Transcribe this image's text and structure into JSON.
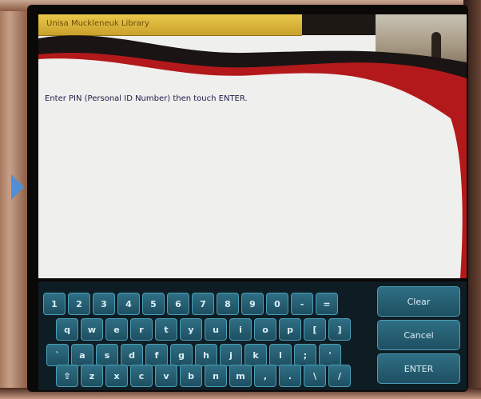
{
  "screen": {
    "library_name": "Unisa Muckleneuk Library",
    "prompt": "Enter PIN (Personal ID Number) then touch ENTER."
  },
  "keyboard": {
    "row1": [
      "1",
      "2",
      "3",
      "4",
      "5",
      "6",
      "7",
      "8",
      "9",
      "0",
      "-",
      "="
    ],
    "row2": [
      "q",
      "w",
      "e",
      "r",
      "t",
      "y",
      "u",
      "i",
      "o",
      "p",
      "[",
      "]"
    ],
    "row3": [
      "`",
      "a",
      "s",
      "d",
      "f",
      "g",
      "h",
      "j",
      "k",
      "l",
      ";",
      "'"
    ],
    "row4": [
      "⇧",
      "z",
      "x",
      "c",
      "v",
      "b",
      "n",
      "m",
      ",",
      ".",
      "\\",
      "/"
    ]
  },
  "actions": {
    "clear": "Clear",
    "cancel": "Cancel",
    "enter": "ENTER"
  },
  "colors": {
    "header_bar": "#d7b43a",
    "swoosh_red": "#b3191b",
    "key_fill": "#27607a",
    "screen_bg": "#efefed"
  }
}
